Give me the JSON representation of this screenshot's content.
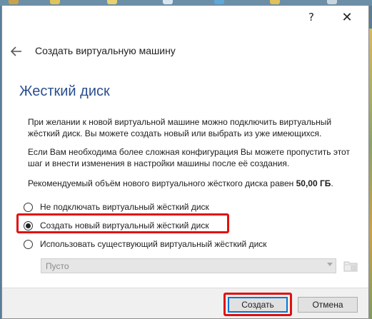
{
  "titlebar": {
    "help_label": "?",
    "close_label": "✕"
  },
  "wizard": {
    "title": "Создать виртуальную машину"
  },
  "page": {
    "heading": "Жесткий диск",
    "paragraph1": "При желании к новой виртуальной машине можно подключить виртуальный жёсткий диск. Вы можете создать новый или выбрать из уже имеющихся.",
    "paragraph2": "Если Вам необходима более сложная конфигурация Вы можете пропустить этот шаг и внести изменения в настройки машины после её создания.",
    "paragraph3_prefix": "Рекомендуемый объём нового виртуального жёсткого диска равен ",
    "paragraph3_value": "50,00 ГБ",
    "paragraph3_suffix": "."
  },
  "options": [
    {
      "label": "Не подключать виртуальный жёсткий диск",
      "selected": false
    },
    {
      "label": "Создать новый виртуальный жёсткий диск",
      "selected": true
    },
    {
      "label": "Использовать существующий виртуальный жёсткий диск",
      "selected": false
    }
  ],
  "existing_disk": {
    "value": "Пусто",
    "enabled": false
  },
  "footer": {
    "create_label": "Создать",
    "cancel_label": "Отмена"
  },
  "colors": {
    "heading": "#2a4f8f",
    "highlight": "#e01010",
    "default_button_border": "#0078d7"
  }
}
